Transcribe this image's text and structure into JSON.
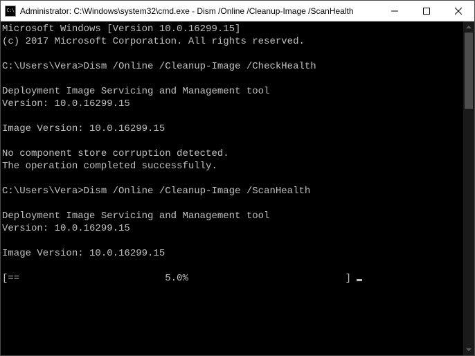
{
  "window": {
    "title": "Administrator: C:\\Windows\\system32\\cmd.exe - Dism  /Online /Cleanup-Image /ScanHealth"
  },
  "console": {
    "header1": "Microsoft Windows [Version 10.0.16299.15]",
    "header2": "(c) 2017 Microsoft Corporation. All rights reserved.",
    "prompt1_path": "C:\\Users\\Vera>",
    "prompt1_cmd": "Dism /Online /Cleanup-Image /CheckHealth",
    "block1_line1": "Deployment Image Servicing and Management tool",
    "block1_line2": "Version: 10.0.16299.15",
    "block1_line3": "Image Version: 10.0.16299.15",
    "block1_line4": "No component store corruption detected.",
    "block1_line5": "The operation completed successfully.",
    "prompt2_path": "C:\\Users\\Vera>",
    "prompt2_cmd": "Dism /Online /Cleanup-Image /ScanHealth",
    "block2_line1": "Deployment Image Servicing and Management tool",
    "block2_line2": "Version: 10.0.16299.15",
    "block2_line3": "Image Version: 10.0.16299.15",
    "progress": "[==                         5.0%                           ] "
  }
}
